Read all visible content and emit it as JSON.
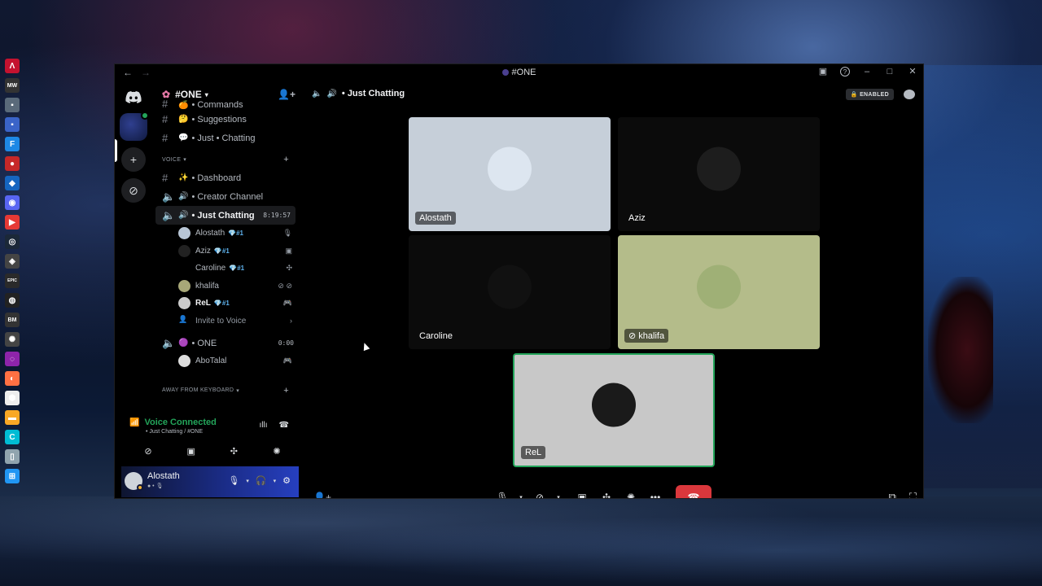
{
  "window": {
    "title": "#ONE",
    "nav": {
      "back": "←",
      "forward": "→"
    },
    "controls": {
      "inbox": "▣",
      "help": "?",
      "minimize": "–",
      "maximize": "□",
      "close": "✕"
    }
  },
  "taskbar": {
    "apps": [
      {
        "name": "adobe-icon",
        "glyph": "Λ",
        "color": "#c4122f"
      },
      {
        "name": "mw-icon",
        "glyph": "MW",
        "color": "#333333"
      },
      {
        "name": "game-icon",
        "glyph": "▪",
        "color": "#5a6a7a"
      },
      {
        "name": "app-icon",
        "glyph": "▪",
        "color": "#3a64c8"
      },
      {
        "name": "f-icon",
        "glyph": "F",
        "color": "#1e88e5"
      },
      {
        "name": "among-us-icon",
        "glyph": "●",
        "color": "#c62828"
      },
      {
        "name": "rocket-league-icon",
        "glyph": "◆",
        "color": "#1565c0"
      },
      {
        "name": "discord-icon",
        "glyph": "◉",
        "color": "#5865f2"
      },
      {
        "name": "youtube-icon",
        "glyph": "▶",
        "color": "#e53935"
      },
      {
        "name": "steam-icon",
        "glyph": "◎",
        "color": "#1b2838"
      },
      {
        "name": "gamepad-icon",
        "glyph": "◈",
        "color": "#444444"
      },
      {
        "name": "epic-icon",
        "glyph": "EPIC",
        "color": "#2a2a2a"
      },
      {
        "name": "obs-icon",
        "glyph": "◍",
        "color": "#222222"
      },
      {
        "name": "bm-icon",
        "glyph": "BM",
        "color": "#333333"
      },
      {
        "name": "settings-app-icon",
        "glyph": "✺",
        "color": "#444444"
      },
      {
        "name": "color-wheel-icon",
        "glyph": "◌",
        "color": "#8e24aa"
      },
      {
        "name": "firefox-icon",
        "glyph": "◐",
        "color": "#ff7043"
      },
      {
        "name": "shield-app-icon",
        "glyph": "⬢",
        "color": "#eeeeee"
      },
      {
        "name": "folder-icon",
        "glyph": "▬",
        "color": "#f9a825"
      },
      {
        "name": "canva-icon",
        "glyph": "C",
        "color": "#00bcd4"
      },
      {
        "name": "recycle-bin-icon",
        "glyph": "▯",
        "color": "#90a4ae"
      },
      {
        "name": "windows-start-icon",
        "glyph": "⊞",
        "color": "#2196f3"
      }
    ]
  },
  "rail": {
    "add_server": "+",
    "explore": "⊘"
  },
  "server": {
    "name": "#ONE",
    "channels_text": [
      {
        "label": "• Commands",
        "emoji": "🍊"
      },
      {
        "label": "• Suggestions",
        "emoji": "🤔"
      },
      {
        "label": "• Just • Chatting",
        "emoji": "💬"
      }
    ],
    "voice_category": "VOICE",
    "voice_channels": [
      {
        "label": "• Dashboard",
        "emoji": "✨",
        "type": "text"
      },
      {
        "label": "• Creator Channel",
        "emoji": "🔊",
        "type": "voice"
      },
      {
        "label": "• Just Chatting",
        "emoji": "🔊",
        "type": "voice",
        "timer": "8:19:57"
      }
    ],
    "members_just_chatting": [
      {
        "name": "Alostath",
        "role": "💎#1",
        "icon": "🎙",
        "avatar": "#b8c6d6",
        "bold": false
      },
      {
        "name": "Aziz",
        "role": "💎#1",
        "icon": "▣",
        "avatar": "#222222",
        "bold": false
      },
      {
        "name": "Caroline",
        "role": "💎#1",
        "icon": "✣",
        "avatar": "#000000",
        "bold": false
      },
      {
        "name": "khalifa",
        "role": "",
        "icon": "⊘ ⊘",
        "avatar": "#a8a878",
        "bold": false
      },
      {
        "name": "ReL",
        "role": "💎#1",
        "icon": "🎮",
        "avatar": "#cccccc",
        "bold": true
      }
    ],
    "invite_label": "Invite to Voice",
    "one_channel": {
      "label": "• ONE",
      "timer": "0:00"
    },
    "one_members": [
      {
        "name": "AboTalal",
        "icon": "🎮"
      }
    ],
    "afk_category": "AWAY FROM KEYBOARD"
  },
  "voice_panel": {
    "status": "Voice Connected",
    "sub": "• Just Chatting / #ONE"
  },
  "user_panel": {
    "name": "Alostath",
    "sub": "● • 🎙"
  },
  "main": {
    "channel_title": "• Just Chatting",
    "enabled_badge": "ENABLED",
    "tiles": [
      {
        "name": "Alostath",
        "bg": "#c6cfd9",
        "avatar": "#dde6f0",
        "label_style": "boxed"
      },
      {
        "name": "Aziz",
        "bg": "#0b0b0b",
        "avatar": "#1d1d1d",
        "label_style": "plain"
      },
      {
        "name": "Caroline",
        "bg": "#0b0b0b",
        "avatar": "#111111",
        "label_style": "plain"
      },
      {
        "name": "khalifa",
        "bg": "#b4bc8a",
        "avatar": "#9fb076",
        "label_style": "boxed",
        "muted_icon": "⊘"
      },
      {
        "name": "ReL",
        "bg": "#c8c8c8",
        "avatar": "#1a1a1a",
        "label_style": "boxed"
      }
    ]
  },
  "colors": {
    "green": "#23a55a",
    "hangup": "#da373c",
    "blurple": "#5865f2"
  }
}
